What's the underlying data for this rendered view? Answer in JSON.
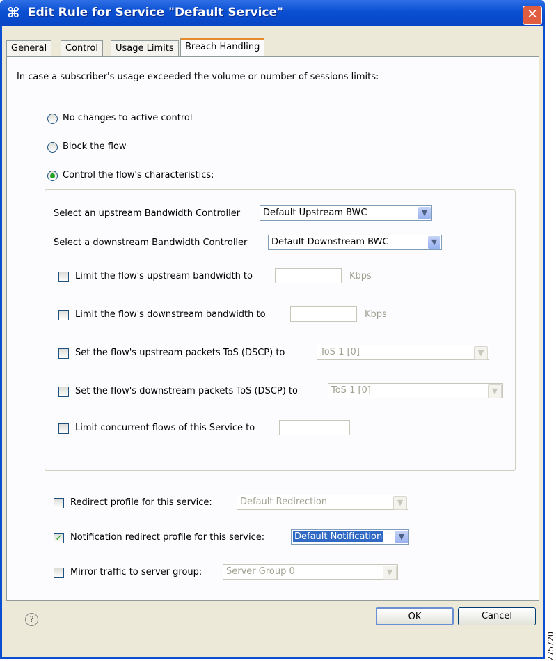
{
  "window": {
    "title": "Edit Rule for Service \"Default Service\"",
    "close_label": "✕"
  },
  "tabs": [
    {
      "label": "General"
    },
    {
      "label": "Control"
    },
    {
      "label": "Usage Limits"
    },
    {
      "label": "Breach Handling"
    }
  ],
  "active_tab": "Breach Handling",
  "panel": {
    "intro": "In case a subscriber's usage exceeded the volume or number of sessions limits:",
    "radios": [
      {
        "label": "No changes to active control",
        "selected": false
      },
      {
        "label": "Block the flow",
        "selected": false
      },
      {
        "label": "Control the flow's characteristics:",
        "selected": true
      }
    ],
    "upstream_bwc": {
      "label": "Select an upstream Bandwidth Controller",
      "value": "Default Upstream BWC"
    },
    "downstream_bwc": {
      "label": "Select a downstream Bandwidth Controller",
      "value": "Default Downstream BWC"
    },
    "limit_upstream": {
      "label": "Limit the flow's upstream bandwidth to",
      "unit": "Kbps",
      "checked": false,
      "value": ""
    },
    "limit_downstream": {
      "label": "Limit the flow's downstream bandwidth to",
      "unit": "Kbps",
      "checked": false,
      "value": ""
    },
    "tos_upstream": {
      "label": "Set the flow's upstream packets ToS (DSCP) to",
      "value": "ToS 1 [0]",
      "checked": false
    },
    "tos_downstream": {
      "label": "Set the flow's downstream packets ToS (DSCP) to",
      "value": "ToS 1 [0]",
      "checked": false
    },
    "limit_concurrent": {
      "label": "Limit concurrent flows of this Service to",
      "checked": false,
      "value": ""
    },
    "redirect_profile": {
      "label": "Redirect profile for this service:",
      "value": "Default Redirection",
      "checked": false
    },
    "notification_profile": {
      "label": "Notification redirect profile for this service:",
      "value": "Default Notification",
      "checked": true
    },
    "mirror_traffic": {
      "label": "Mirror traffic to server group:",
      "value": "Server Group 0",
      "checked": false
    }
  },
  "footer": {
    "help": "?",
    "ok_label": "OK",
    "cancel_label": "Cancel"
  },
  "watermark": "275720",
  "icons": {
    "title": "service-rule-icon",
    "help": "help-icon",
    "dropdown": "chevron-down-icon"
  },
  "colors": {
    "titlebar": "#0a4fd2",
    "active_tab_accent": "#e68b2c",
    "selection": "#316ac5",
    "close": "#e15d3f"
  }
}
